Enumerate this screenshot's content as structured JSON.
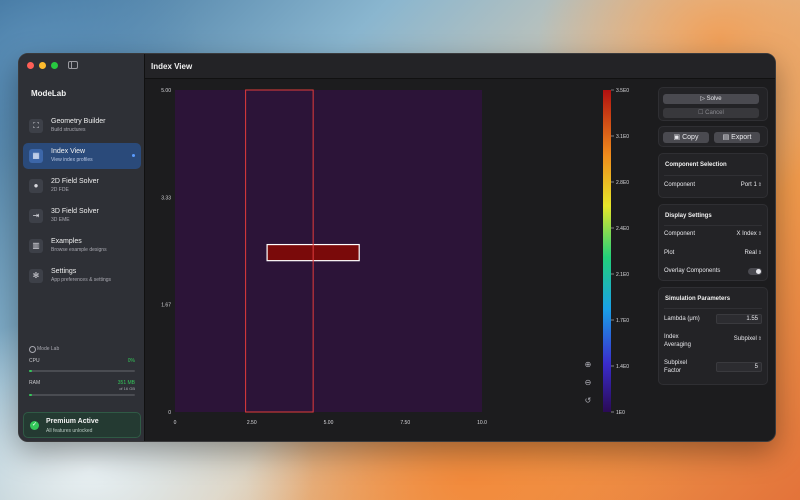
{
  "app": {
    "name": "ModeLab"
  },
  "sidebar": {
    "items": [
      {
        "label": "Geometry Builder",
        "sub": "Build structures",
        "icon": "geometry-icon"
      },
      {
        "label": "Index View",
        "sub": "View index profiles",
        "icon": "grid-icon"
      },
      {
        "label": "2D Field Solver",
        "sub": "2D FDE",
        "icon": "circle-icon"
      },
      {
        "label": "3D Field Solver",
        "sub": "3D EME",
        "icon": "split-icon"
      },
      {
        "label": "Examples",
        "sub": "Browse example designs",
        "icon": "books-icon"
      },
      {
        "label": "Settings",
        "sub": "App preferences & settings",
        "icon": "gear-icon"
      }
    ],
    "active_index": 1
  },
  "stats": {
    "title": "Mode Lab",
    "cpu_label": "CPU",
    "cpu_value": "0%",
    "cpu_fraction": 0.03,
    "ram_label": "RAM",
    "ram_value": "351 MB",
    "ram_total": "of 16 GB",
    "ram_fraction": 0.03
  },
  "premium": {
    "title": "Premium Active",
    "subtitle": "All features unlocked"
  },
  "main": {
    "title": "Index View"
  },
  "chart_data": {
    "type": "heatmap",
    "xlim": [
      0,
      10
    ],
    "ylim": [
      0,
      5
    ],
    "x_ticks": [
      "0",
      "2.50",
      "5.00",
      "7.50",
      "10.0"
    ],
    "y_ticks": [
      "5.00",
      "3.33",
      "1.67",
      "0"
    ],
    "colorbar_ticks": [
      "3.5E0",
      "3.1E0",
      "2.8E0",
      "2.4E0",
      "2.1E0",
      "1.7E0",
      "1.4E0",
      "1E0"
    ],
    "colorbar_range": [
      1.0,
      3.5
    ],
    "background_value": 1.0,
    "regions": [
      {
        "x": [
          0,
          10
        ],
        "y": [
          0,
          5
        ],
        "value": 1.0
      },
      {
        "x": [
          3.0,
          6.0
        ],
        "y": [
          2.35,
          2.6
        ],
        "value": 3.5
      }
    ],
    "highlight_box": {
      "x": [
        2.3,
        4.5
      ],
      "y": [
        0,
        5
      ],
      "color": "#e23b3b"
    },
    "grid": false
  },
  "toolbar": {
    "solve_label": "Solve",
    "cancel_label": "Cancel",
    "copy_label": "Copy",
    "export_label": "Export"
  },
  "component_selection": {
    "title": "Component Selection",
    "component_label": "Component",
    "component_value": "Port 1"
  },
  "display_settings": {
    "title": "Display Settings",
    "component_label": "Component",
    "component_value": "X Index",
    "plot_label": "Plot",
    "plot_value": "Real",
    "overlay_label": "Overlay Components",
    "overlay_on": false
  },
  "simulation": {
    "title": "Simulation Parameters",
    "lambda_label": "Lambda (μm)",
    "lambda_value": "1.55",
    "averaging_label_1": "Index",
    "averaging_label_2": "Averaging",
    "averaging_value": "Subpixel",
    "subpixel_label_1": "Subpixel",
    "subpixel_label_2": "Factor",
    "subpixel_value": "5"
  },
  "colors": {
    "heatmap_bg": "#2c1438",
    "core": "#7a0a0a",
    "highlight": "#e23b3b",
    "accent_green": "#34c759"
  }
}
